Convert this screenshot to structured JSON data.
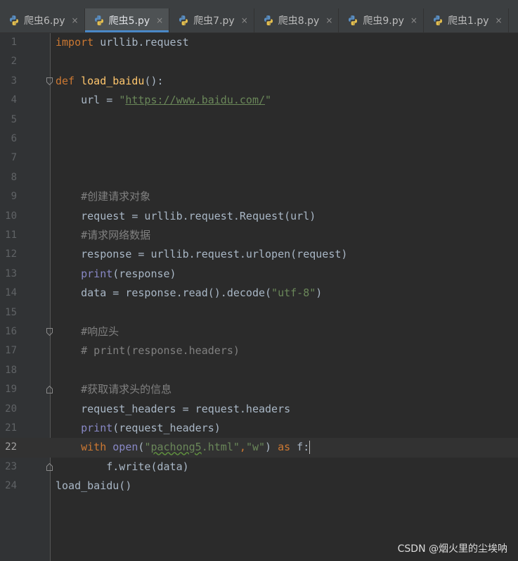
{
  "tabs": [
    {
      "label": "爬虫6.py",
      "active": false
    },
    {
      "label": "爬虫5.py",
      "active": true
    },
    {
      "label": "爬虫7.py",
      "active": false
    },
    {
      "label": "爬虫8.py",
      "active": false
    },
    {
      "label": "爬虫9.py",
      "active": false
    },
    {
      "label": "爬虫1.py",
      "active": false
    }
  ],
  "close_glyph": "×",
  "current_line": 22,
  "lines": [
    {
      "n": "1",
      "segs": [
        {
          "t": "import",
          "c": "kw"
        },
        {
          "t": " urllib.request",
          "c": ""
        }
      ]
    },
    {
      "n": "2",
      "segs": []
    },
    {
      "n": "3",
      "fold": "open",
      "segs": [
        {
          "t": "def",
          "c": "kw"
        },
        {
          "t": " ",
          "c": ""
        },
        {
          "t": "load_baidu",
          "c": "fn"
        },
        {
          "t": "():",
          "c": ""
        }
      ]
    },
    {
      "n": "4",
      "segs": [
        {
          "t": "    url = ",
          "c": ""
        },
        {
          "t": "\"",
          "c": "str"
        },
        {
          "t": "https://www.baidu.com/",
          "c": "str url"
        },
        {
          "t": "\"",
          "c": "str"
        }
      ]
    },
    {
      "n": "5",
      "segs": []
    },
    {
      "n": "6",
      "segs": []
    },
    {
      "n": "7",
      "segs": []
    },
    {
      "n": "8",
      "segs": []
    },
    {
      "n": "9",
      "segs": [
        {
          "t": "    #创建请求对象",
          "c": "cm"
        }
      ]
    },
    {
      "n": "10",
      "segs": [
        {
          "t": "    request = urllib.request.Request(url)",
          "c": ""
        }
      ]
    },
    {
      "n": "11",
      "segs": [
        {
          "t": "    #请求网络数据",
          "c": "cm"
        }
      ]
    },
    {
      "n": "12",
      "segs": [
        {
          "t": "    response = urllib.request.urlopen(request)",
          "c": ""
        }
      ]
    },
    {
      "n": "13",
      "segs": [
        {
          "t": "    ",
          "c": ""
        },
        {
          "t": "print",
          "c": "bi"
        },
        {
          "t": "(response)",
          "c": ""
        }
      ]
    },
    {
      "n": "14",
      "segs": [
        {
          "t": "    data = response.read().decode(",
          "c": ""
        },
        {
          "t": "\"utf-8\"",
          "c": "str"
        },
        {
          "t": ")",
          "c": ""
        }
      ]
    },
    {
      "n": "15",
      "segs": []
    },
    {
      "n": "16",
      "fold": "open",
      "segs": [
        {
          "t": "    #响应头",
          "c": "cm"
        }
      ]
    },
    {
      "n": "17",
      "segs": [
        {
          "t": "    # print(response.headers)",
          "c": "cm"
        }
      ]
    },
    {
      "n": "18",
      "segs": []
    },
    {
      "n": "19",
      "fold": "end",
      "segs": [
        {
          "t": "    #获取请求头的信息",
          "c": "cm"
        }
      ]
    },
    {
      "n": "20",
      "segs": [
        {
          "t": "    request_headers = request.headers",
          "c": ""
        }
      ]
    },
    {
      "n": "21",
      "segs": [
        {
          "t": "    ",
          "c": ""
        },
        {
          "t": "print",
          "c": "bi"
        },
        {
          "t": "(request_headers)",
          "c": ""
        }
      ]
    },
    {
      "n": "22",
      "segs": [
        {
          "t": "    ",
          "c": ""
        },
        {
          "t": "with",
          "c": "kw"
        },
        {
          "t": " ",
          "c": ""
        },
        {
          "t": "open",
          "c": "bi"
        },
        {
          "t": "(",
          "c": ""
        },
        {
          "t": "\"",
          "c": "str"
        },
        {
          "t": "pachong5",
          "c": "str squiggle"
        },
        {
          "t": ".html\"",
          "c": "str"
        },
        {
          "t": ",",
          "c": "kw"
        },
        {
          "t": "\"w\"",
          "c": "str"
        },
        {
          "t": ") ",
          "c": ""
        },
        {
          "t": "as",
          "c": "kw"
        },
        {
          "t": " f:",
          "c": ""
        }
      ],
      "caret": true
    },
    {
      "n": "23",
      "fold": "end",
      "segs": [
        {
          "t": "        f.write(data)",
          "c": ""
        }
      ]
    },
    {
      "n": "24",
      "segs": [
        {
          "t": "load_baidu()",
          "c": ""
        }
      ]
    }
  ],
  "watermark": "CSDN @烟火里的尘埃呐"
}
